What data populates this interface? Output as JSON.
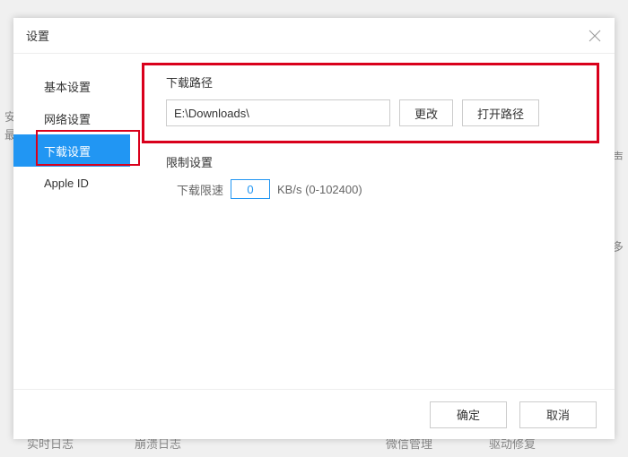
{
  "dialog": {
    "title": "设置"
  },
  "sidebar": {
    "items": [
      {
        "label": "基本设置"
      },
      {
        "label": "网络设置"
      },
      {
        "label": "下载设置"
      },
      {
        "label": "Apple ID"
      }
    ]
  },
  "content": {
    "download_path": {
      "title": "下载路径",
      "value": "E:\\Downloads\\",
      "change_label": "更改",
      "open_label": "打开路径"
    },
    "limit": {
      "title": "限制设置",
      "speed_label": "下载限速",
      "speed_value": "0",
      "unit_hint": "KB/s (0-102400)"
    }
  },
  "footer": {
    "ok": "确定",
    "cancel": "取消"
  },
  "background": {
    "t1": "安",
    "t2": "最",
    "r1": "声",
    "r2": "多",
    "b1": "实时日志",
    "b2": "崩溃日志",
    "b3": "微信管理",
    "b4": "驱动修复"
  }
}
